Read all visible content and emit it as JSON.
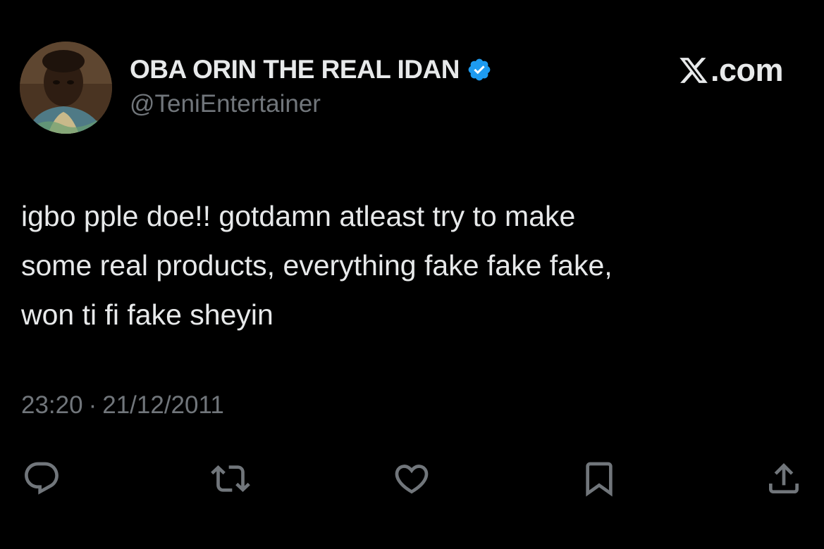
{
  "author": {
    "display_name": "OBA ORIN THE REAL IDAN",
    "handle": "@TeniEntertainer",
    "verified": true,
    "avatar_icon": "avatar-photo"
  },
  "brand": {
    "icon": "x-logo-icon",
    "text": ".com"
  },
  "tweet": {
    "lines": [
      "igbo pple doe!! gotdamn atleast try to make",
      "some real products, everything fake fake fake,",
      "won ti fi fake sheyin"
    ]
  },
  "meta": {
    "time": "23:20",
    "separator": "·",
    "date": "21/12/2011"
  },
  "actions": [
    {
      "name": "reply",
      "icon": "reply-icon"
    },
    {
      "name": "repost",
      "icon": "repost-icon"
    },
    {
      "name": "like",
      "icon": "heart-icon"
    },
    {
      "name": "bookmark",
      "icon": "bookmark-icon"
    },
    {
      "name": "share",
      "icon": "share-icon"
    }
  ],
  "colors": {
    "background": "#000000",
    "text": "#e7e9ea",
    "secondary": "#71767b",
    "verified": "#1d9bf0"
  }
}
